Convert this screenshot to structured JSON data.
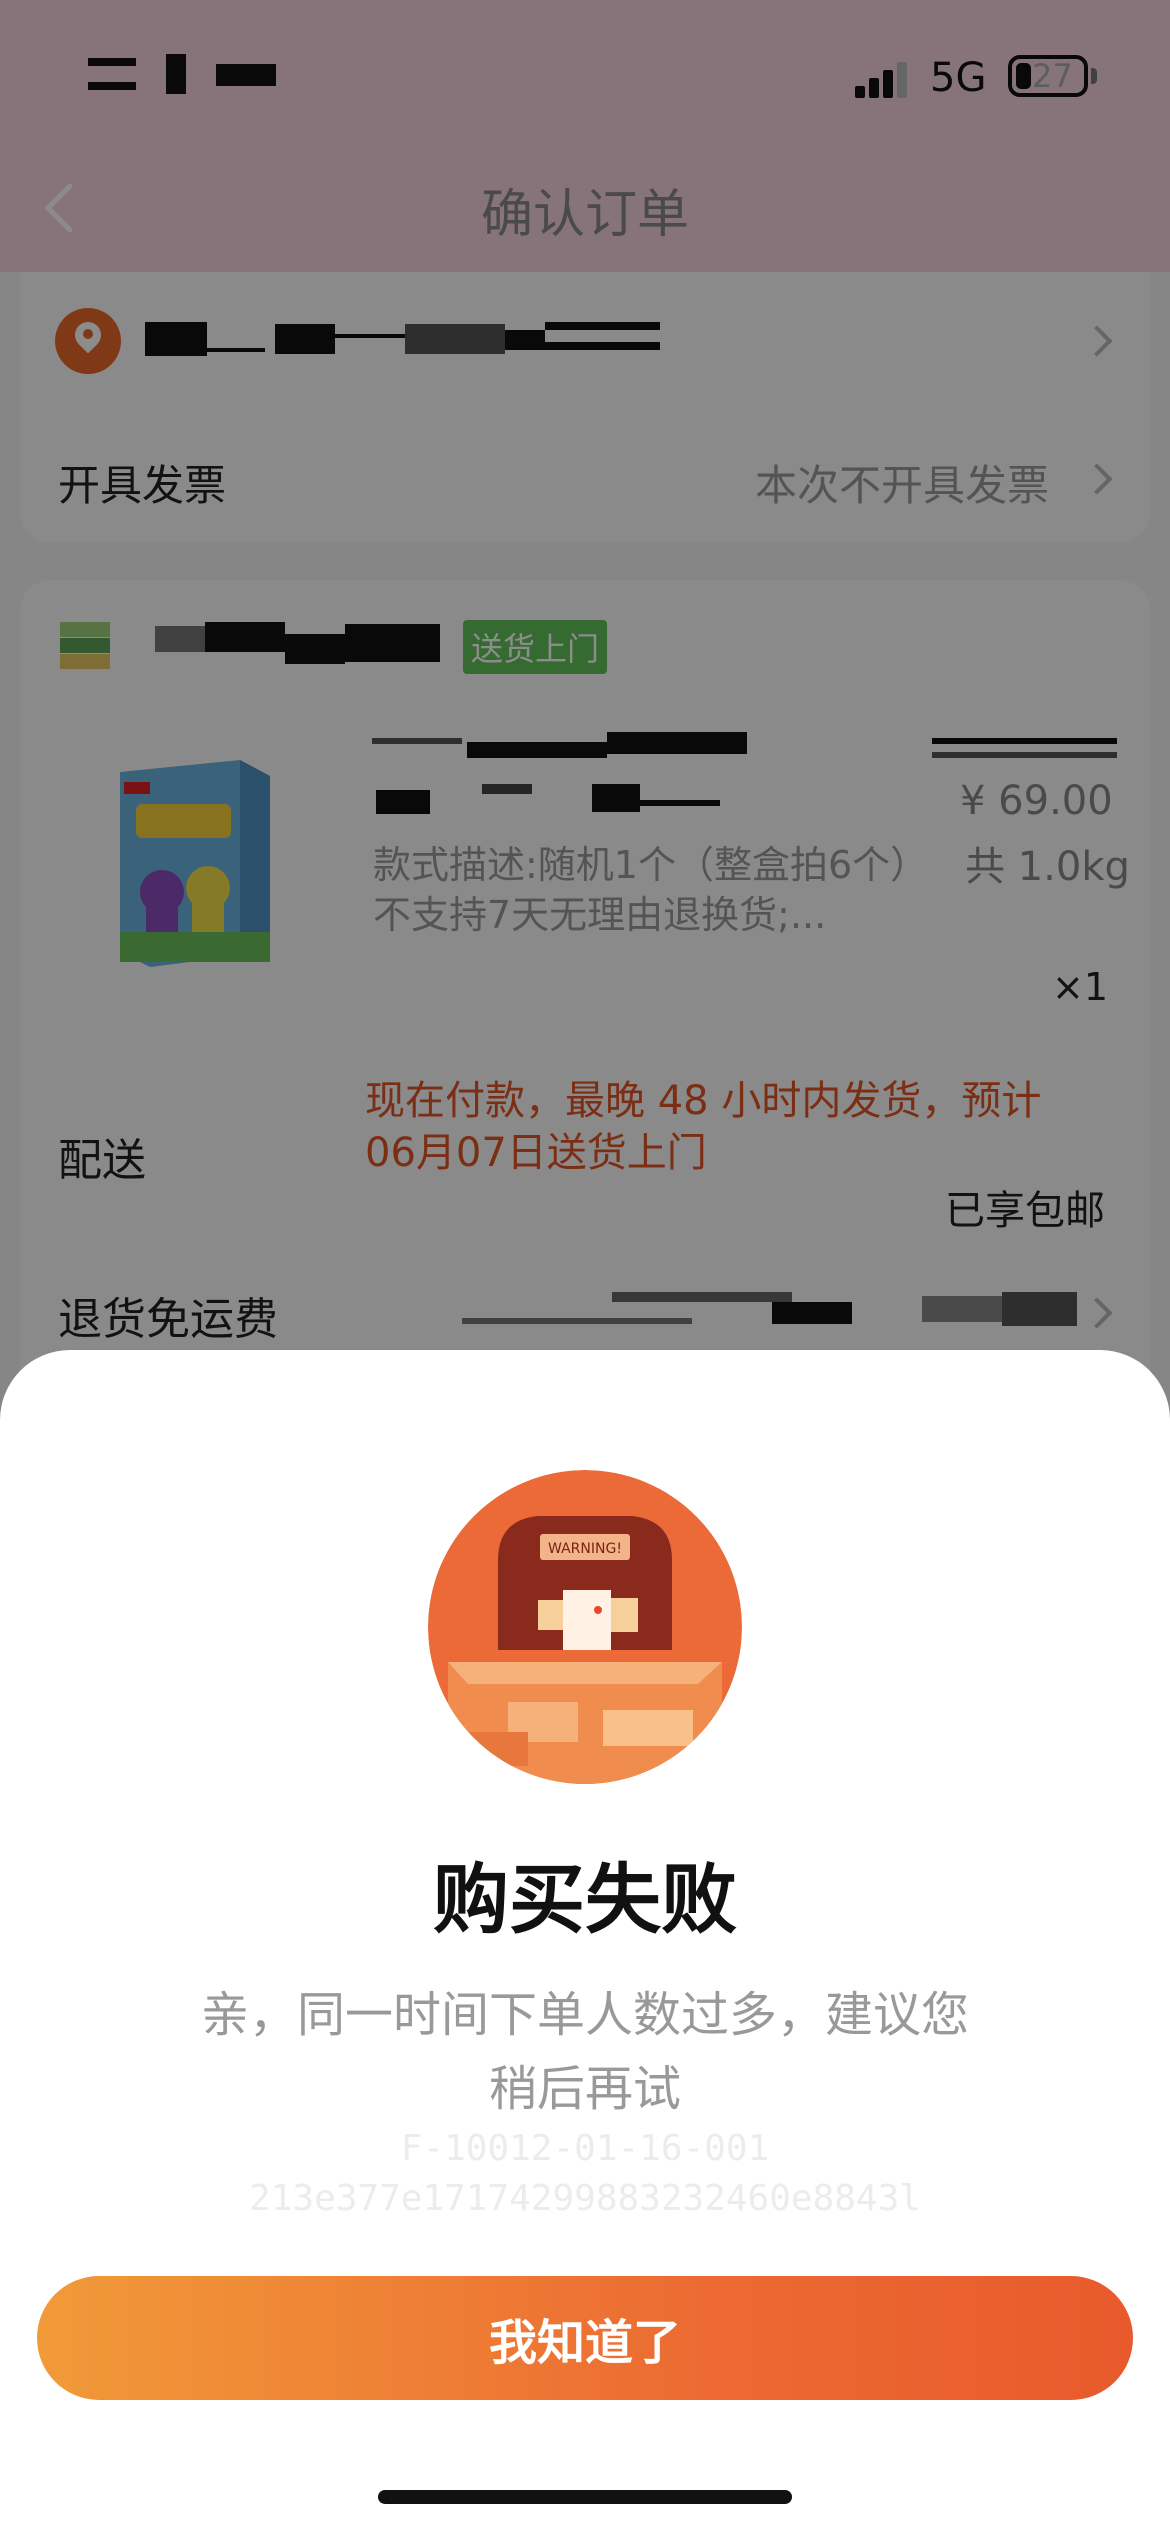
{
  "status_bar": {
    "network": "5G",
    "battery": "27"
  },
  "header": {
    "title": "确认订单"
  },
  "invoice": {
    "label": "开具发票",
    "value": "本次不开具发票"
  },
  "order": {
    "delivery_tag": "送货上门",
    "product": {
      "price": "¥ 69.00",
      "weight": "共 1.0kg",
      "description": "款式描述:随机1个（整盒拍6个）不支持7天无理由退换货;...",
      "quantity": "×1"
    },
    "shipping": {
      "label": "配送",
      "note": "现在付款，最晚 48 小时内发货，预计 06月07日送货上门",
      "free_shipping": "已享包邮"
    },
    "return_shipping": {
      "label": "退货免运费"
    }
  },
  "dialog": {
    "illustration_text": "WARNING!",
    "title": "购买失败",
    "message": "亲，同一时间下单人数过多，建议您稍后再试",
    "error_code_line1": "F-10012-01-16-001",
    "error_code_line2": "213e377e17174299883232460e8843l",
    "confirm_label": "我知道了"
  },
  "colors": {
    "accent": "#ec6b32",
    "header_bg": "#f6d3df",
    "tag_green": "#62c15a",
    "ship_note": "#e15525"
  },
  "icons": [
    "back-chevron-icon",
    "location-pin-icon",
    "chevron-right-icon",
    "shop-icon",
    "signal-icon",
    "battery-icon"
  ]
}
